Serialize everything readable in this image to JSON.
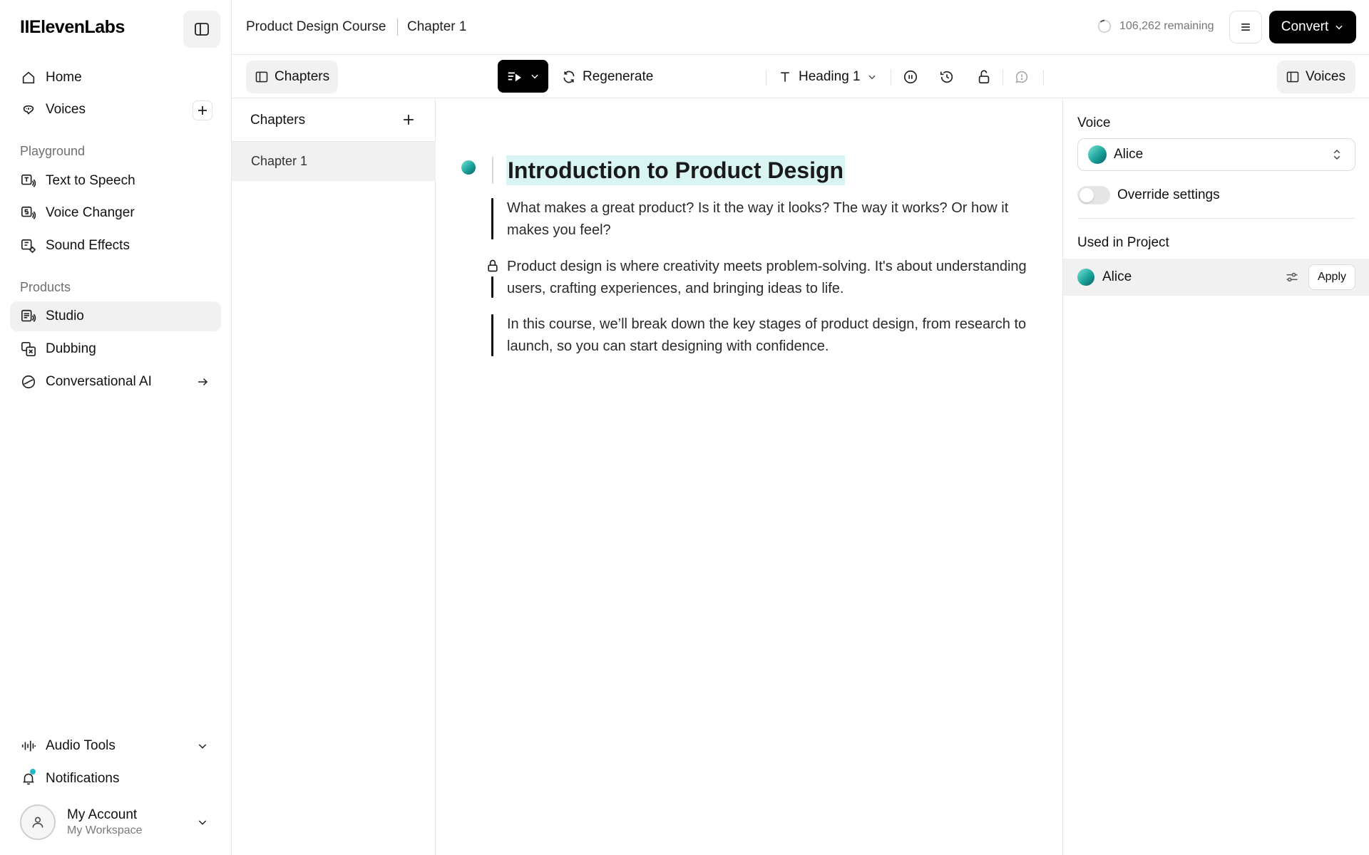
{
  "app": {
    "logo": "IIElevenLabs"
  },
  "sidebar": {
    "top_items": [
      {
        "label": "Home",
        "icon": "home-icon"
      },
      {
        "label": "Voices",
        "icon": "voices-icon"
      }
    ],
    "playground_label": "Playground",
    "playground_items": [
      {
        "label": "Text to Speech",
        "icon": "text-to-speech-icon"
      },
      {
        "label": "Voice Changer",
        "icon": "voice-changer-icon"
      },
      {
        "label": "Sound Effects",
        "icon": "sound-effects-icon"
      }
    ],
    "products_label": "Products",
    "products_items": [
      {
        "label": "Studio",
        "icon": "studio-icon",
        "active": true
      },
      {
        "label": "Dubbing",
        "icon": "dubbing-icon"
      },
      {
        "label": "Conversational AI",
        "icon": "conversational-ai-icon"
      }
    ],
    "bottom_items": [
      {
        "label": "Audio Tools",
        "icon": "audio-tools-icon"
      },
      {
        "label": "Notifications",
        "icon": "bell-icon"
      }
    ],
    "account": {
      "name": "My Account",
      "workspace": "My Workspace"
    }
  },
  "header": {
    "breadcrumb": [
      "Product Design Course",
      "Chapter 1"
    ],
    "remaining": "106,262 remaining",
    "convert_label": "Convert"
  },
  "toolbar": {
    "chapters_label": "Chapters",
    "regenerate_label": "Regenerate",
    "heading_label": "Heading 1",
    "voices_label": "Voices"
  },
  "chapters_panel": {
    "title": "Chapters",
    "items": [
      "Chapter 1"
    ]
  },
  "editor": {
    "heading": "Introduction to Product Design",
    "paragraphs": [
      "What makes a great product? Is it the way it looks? The way it works? Or how it makes you feel?",
      "Product design is where creativity meets problem-solving. It's about understanding users, crafting experiences, and bringing ideas to life.",
      "In this course, we’ll break down the key stages of product design, from research to launch, so you can start designing with confidence."
    ]
  },
  "voice_panel": {
    "voice_title": "Voice",
    "selected_voice": "Alice",
    "override_label": "Override settings",
    "override_enabled": false,
    "used_title": "Used in Project",
    "used_voices": [
      {
        "name": "Alice",
        "apply_label": "Apply"
      }
    ]
  },
  "colors": {
    "accent": "#21b8c8",
    "highlight": "#d9f5f3",
    "primary_button": "#000000"
  }
}
